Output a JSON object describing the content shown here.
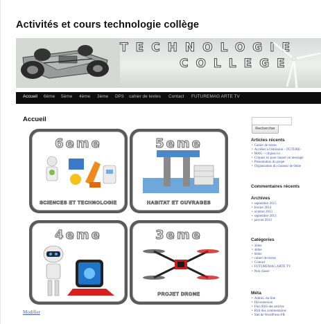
{
  "site": {
    "title": "Activités et cours technologie collège"
  },
  "banner": {
    "line1": "TECHNOLOGIE",
    "line2": "COLLEGE"
  },
  "nav": {
    "items": [
      "Accueil",
      "6ème",
      "5ème",
      "4ème",
      "3ème",
      "DP3",
      "cahier de textes",
      "Contact",
      "FUTUREMAG ARTE TV"
    ]
  },
  "content": {
    "title": "Accueil",
    "tiles": [
      {
        "head": "6eme",
        "caption": "SCIENCES ET TECHNOLOGIE"
      },
      {
        "head": "5eme",
        "caption": "HABITAT ET OUVRAGES"
      },
      {
        "head": "4eme",
        "caption": ""
      },
      {
        "head": "3eme",
        "caption": "PROJET DRONE"
      }
    ],
    "modify_link": "Modifier"
  },
  "sidebar": {
    "search_button": "Rechercher",
    "recent_posts": {
      "title": "Articles récents",
      "items": [
        "Cahier de textes",
        "Accéder à l'émission – FUTURE-",
        "MAG – cliquez ici",
        "Cliquez ici pour laisser un message",
        "Présentation du projet",
        "Organisation du classeur de 6ème"
      ]
    },
    "recent_comments": {
      "title": "Commentaires récents"
    },
    "archives": {
      "title": "Archives",
      "items": [
        "septembre 2015",
        "février 2014",
        "octobre 2013",
        "septembre 2013",
        "janvier 2013"
      ]
    },
    "categories": {
      "title": "Catégories",
      "items": [
        "3ème",
        "4ème",
        "6ème",
        "cahier de textes",
        "Contact",
        "FUTUREMAG ARTE TV",
        "Non classé"
      ]
    },
    "meta": {
      "title": "Méta",
      "items": [
        "Admin. du Site",
        "Déconnexion",
        "Flux RSS des articles",
        "RSS des commentaires",
        "Site de WordPress-FR"
      ]
    }
  },
  "colors": {
    "nav_bg": "#0e0e0e",
    "link": "#3f4fa0",
    "tile_border": "#5a5a5a"
  }
}
